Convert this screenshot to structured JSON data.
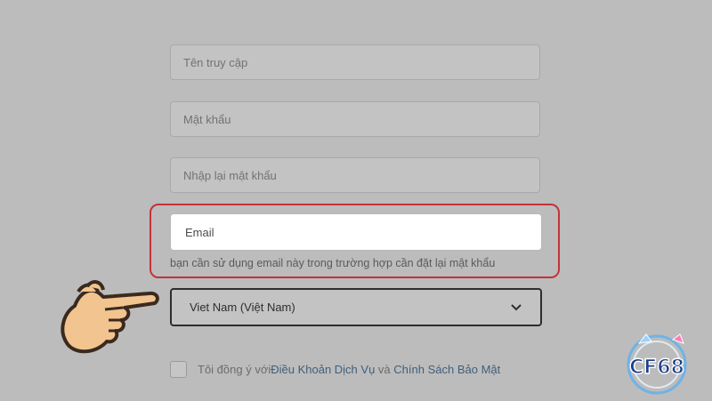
{
  "form": {
    "username_placeholder": "Tên truy cập",
    "password_placeholder": "Mật khẩu",
    "confirm_password_placeholder": "Nhập lại mật khẩu",
    "email_placeholder": "Email",
    "email_helper": "bạn cần sử dụng email này trong trường hợp cần đặt lại mật khẩu",
    "country_selected": "Viet Nam (Việt Nam)",
    "terms_prefix": "Tôi đồng ý với ",
    "terms_link": "Điều Khoản Dịch Vụ",
    "terms_and": " và ",
    "privacy_link": "Chính Sách Bảo Mật"
  },
  "logo": {
    "text": "CF68"
  },
  "colors": {
    "highlight": "#c5323a",
    "link": "#3f5f7a",
    "overlay": "#bcbcbc",
    "hand_skin": "#f2c48f"
  },
  "icons": [
    "pointing-hand-icon",
    "chevron-down-icon"
  ]
}
